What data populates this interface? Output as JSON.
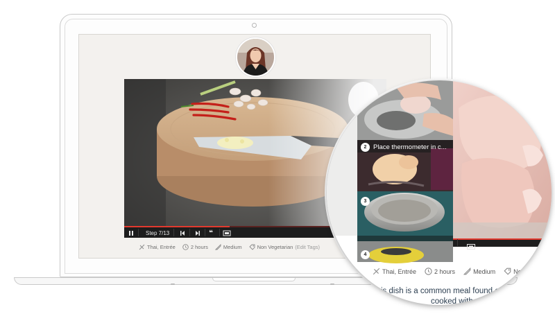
{
  "player": {
    "step_label": "Step 7/13",
    "quote_icon": "quote-icon",
    "progress": 0.46
  },
  "tags": {
    "cuisine": "Thai, Entrée",
    "time": "2 hours",
    "difficulty": "Medium",
    "diet": "Non Vegetarian",
    "edit_tags": "(Edit Tags)"
  },
  "zoom": {
    "steps": [
      {
        "number": "2",
        "title": "Place thermometer in c..."
      },
      {
        "number": "3",
        "title": ""
      },
      {
        "number": "4",
        "title": ""
      }
    ],
    "tags": {
      "cuisine": "Thai, Entrée",
      "time": "2 hours",
      "difficulty": "Medium",
      "diet": "Non Vege"
    },
    "description": [
      "is dish is a common meal found on",
      "cooked with chi"
    ]
  },
  "colors": {
    "accent": "#e3392e",
    "controls_bg": "#1d1d1d",
    "text_link": "#2c3e50"
  }
}
